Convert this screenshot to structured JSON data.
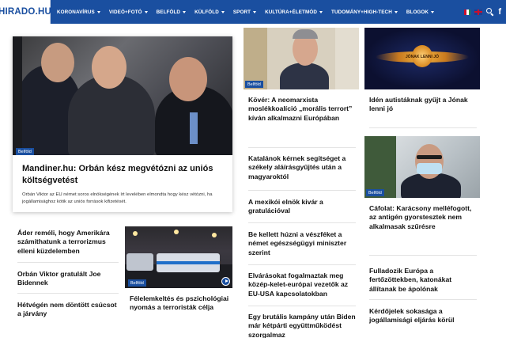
{
  "site": {
    "logo": "HIRADO.HU",
    "menu": [
      {
        "label": "KORONAVÍRUS"
      },
      {
        "label": "VIDEÓ+FOTÓ"
      },
      {
        "label": "BELFÖLD"
      },
      {
        "label": "KÜLFÖLD"
      },
      {
        "label": "SPORT"
      },
      {
        "label": "KULTÚRA+ÉLETMÓD"
      },
      {
        "label": "TUDOMÁNY+HIGH-TECH"
      },
      {
        "label": "BLOGOK"
      }
    ],
    "facebook_glyph": "f",
    "accent_color": "#1a4fa0"
  },
  "feature": {
    "badge": "Belföld",
    "title": "Mandiner.hu: Orbán kész megvétózni az uniós költségvetést",
    "lead": "Orbán Viktor az EU német soros elnökségének írt levelében elmondta hogy kész vétózni, ha jogállamisághoz kötik az uniós források kifizetését."
  },
  "left_list": [
    {
      "title": "Áder reméli, hogy Amerikára számíthatunk a terrorizmus elleni küzdelemben"
    },
    {
      "title": "Orbán Viktor gratulált Joe Bidennek"
    },
    {
      "title": "Hétvégén nem döntött csúcsot a járvány"
    }
  ],
  "video_card": {
    "badge": "Belföld",
    "title": "Félelemkeltés és pszichológiai nyomás a terroristák célja",
    "play_icon": "play-icon"
  },
  "center": {
    "top_card": {
      "badge": "Belföld",
      "title": "Kövér: A neomarxista moslékkoalíció „morális terrort” kíván alkalmazni Európában"
    },
    "list": [
      {
        "title": "Katalánok kérnek segítséget a székely aláírásgyűjtés után a magyaroktól"
      },
      {
        "title": "A mexikói elnök kivár a gratulációval"
      },
      {
        "title": "Be kellett húzni a vészféket a német egészségügyi miniszter szerint"
      },
      {
        "title": "Elvárásokat fogalmaztak meg közép-kelet-európai vezetők az EU-USA kapcsolatokban"
      },
      {
        "title": "Egy brutális kampány után Biden már kétpárti együttműködést szorgalmaz"
      }
    ]
  },
  "right": {
    "top_card": {
      "title": "Idén autistáknak gyűjt a Jónak lenni jó",
      "logo_text": "JÓNAK LENNI JÓ"
    },
    "second_card": {
      "badge": "Belföld",
      "title": "Cáfolat: Karácsony melléfogott, az antigén gyorstesztek nem alkalmasak szűrésre"
    },
    "list": [
      {
        "title": "Fulladozik Európa a fertőzöttekben, katonákat állítanak be ápolónak"
      },
      {
        "title": "Kérdőjelek sokasága a jogállamisági eljárás körül"
      }
    ]
  }
}
